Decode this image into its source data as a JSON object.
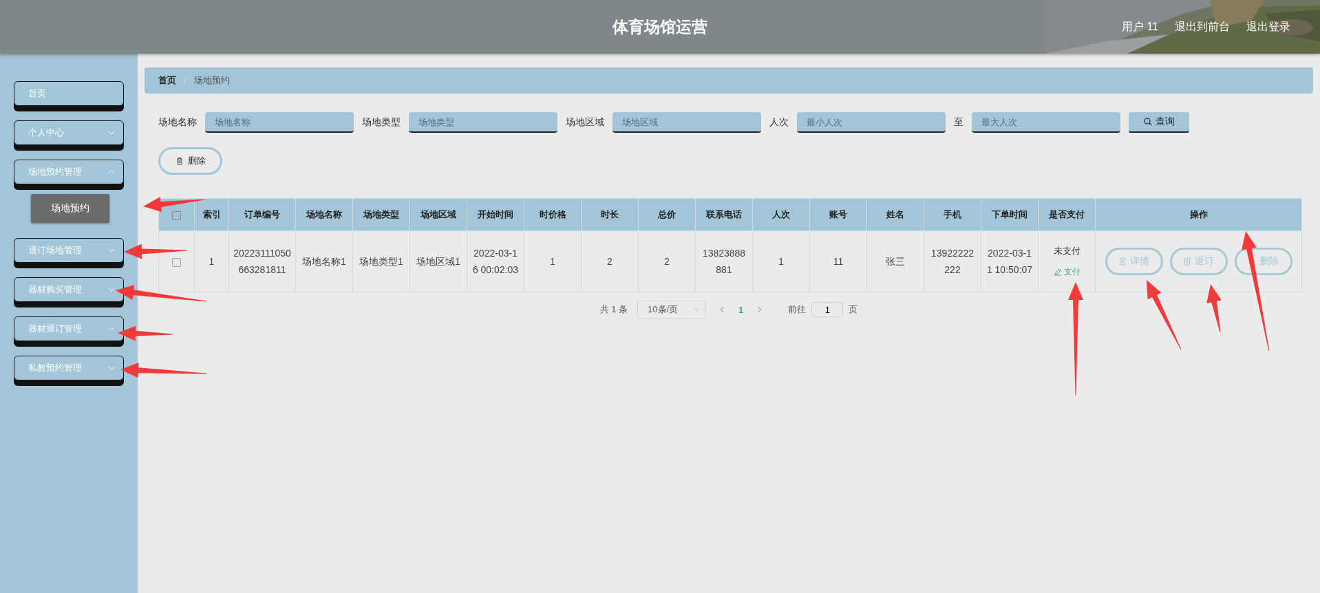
{
  "header": {
    "title": "体育场馆运营",
    "links": [
      "用户 11",
      "退出到前台",
      "退出登录"
    ]
  },
  "sidebar": {
    "items": [
      {
        "kind": "link",
        "label": "首页"
      },
      {
        "kind": "submenu",
        "label": "个人中心",
        "expanded": false
      },
      {
        "kind": "submenu",
        "label": "场地预约管理",
        "expanded": true,
        "children": [
          {
            "label": "场地预约",
            "selected": true
          }
        ]
      },
      {
        "kind": "submenu",
        "label": "退订场地管理",
        "expanded": false
      },
      {
        "kind": "submenu",
        "label": "器材购买管理",
        "expanded": false
      },
      {
        "kind": "submenu",
        "label": "器材退订管理",
        "expanded": false
      },
      {
        "kind": "submenu",
        "label": "私教预约管理",
        "expanded": false
      }
    ]
  },
  "breadcrumb": [
    "首页",
    "场地预约"
  ],
  "filters": [
    {
      "label": "场地名称",
      "placeholder": "场地名称"
    },
    {
      "label": "场地类型",
      "placeholder": "场地类型"
    },
    {
      "label": "场地区域",
      "placeholder": "场地区域"
    },
    {
      "label": "人次",
      "placeholder": "最小人次"
    },
    {
      "label": "至",
      "placeholder": "最大人次"
    }
  ],
  "search_button": "查询",
  "delete_button": "删除",
  "table": {
    "select_all_checked": false,
    "columns": [
      "索引",
      "订单编号",
      "场地名称",
      "场地类型",
      "场地区域",
      "开始时间",
      "时价格",
      "时长",
      "总价",
      "联系电话",
      "人次",
      "账号",
      "姓名",
      "手机",
      "下单时间",
      "是否支付",
      "操作"
    ],
    "rows": [
      {
        "checked": false,
        "cells": [
          "1",
          "20223111050663281811",
          "场地名称1",
          "场地类型1",
          "场地区域1",
          "2022-03-16 00:02:03",
          "1",
          "2",
          "2",
          "13823888881",
          "1",
          "11",
          "张三",
          "13922222222",
          "2022-03-11 10:50:07"
        ],
        "payment_status": "未支付",
        "pay_link": "支付",
        "actions": [
          "详情",
          "退订",
          "删除"
        ]
      }
    ]
  },
  "pagination": {
    "total": "共 1 条",
    "page_size": "10条/页",
    "pages": [
      {
        "label": "1",
        "selected": true
      }
    ],
    "goto_label": "前往",
    "goto_value": "1",
    "goto_suffix": "页"
  }
}
